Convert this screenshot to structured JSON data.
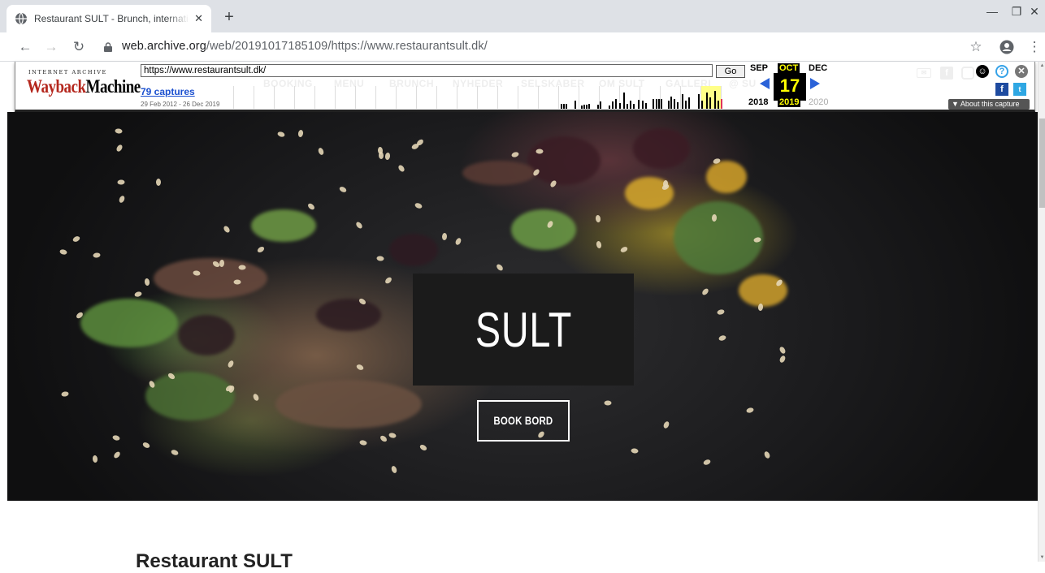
{
  "browser": {
    "tab_title": "Restaurant SULT - Brunch, internationale retter",
    "new_tab": "+",
    "url_host": "web.archive.org",
    "url_path": "/web/20191017185109/https://www.restaurantsult.dk/",
    "window_minimize": "—",
    "window_restore": "❐",
    "window_close": "✕"
  },
  "wayback": {
    "logo_top": "INTERNET ARCHIVE",
    "logo_main_a": "Wayback",
    "logo_main_b": "Machine",
    "url_value": "https://www.restaurantsult.dk/",
    "go_label": "Go",
    "captures": "79 captures",
    "range": "29 Feb 2012 - 26 Dec 2019",
    "prev_month": "SEP",
    "cur_month": "OCT",
    "next_month": "DEC",
    "day": "17",
    "prev_year": "2018",
    "cur_year": "2019",
    "next_year": "2020",
    "about": "About this capture",
    "ghost_nav": [
      "BOOKING",
      "MENU",
      "BRUNCH",
      "NYHEDER",
      "SELSKABER",
      "OM SULT",
      "GALLERI",
      "@ SU"
    ]
  },
  "page": {
    "logo": "SULT",
    "book_button": "BOOK BORD",
    "section_title": "Restaurant SULT"
  }
}
